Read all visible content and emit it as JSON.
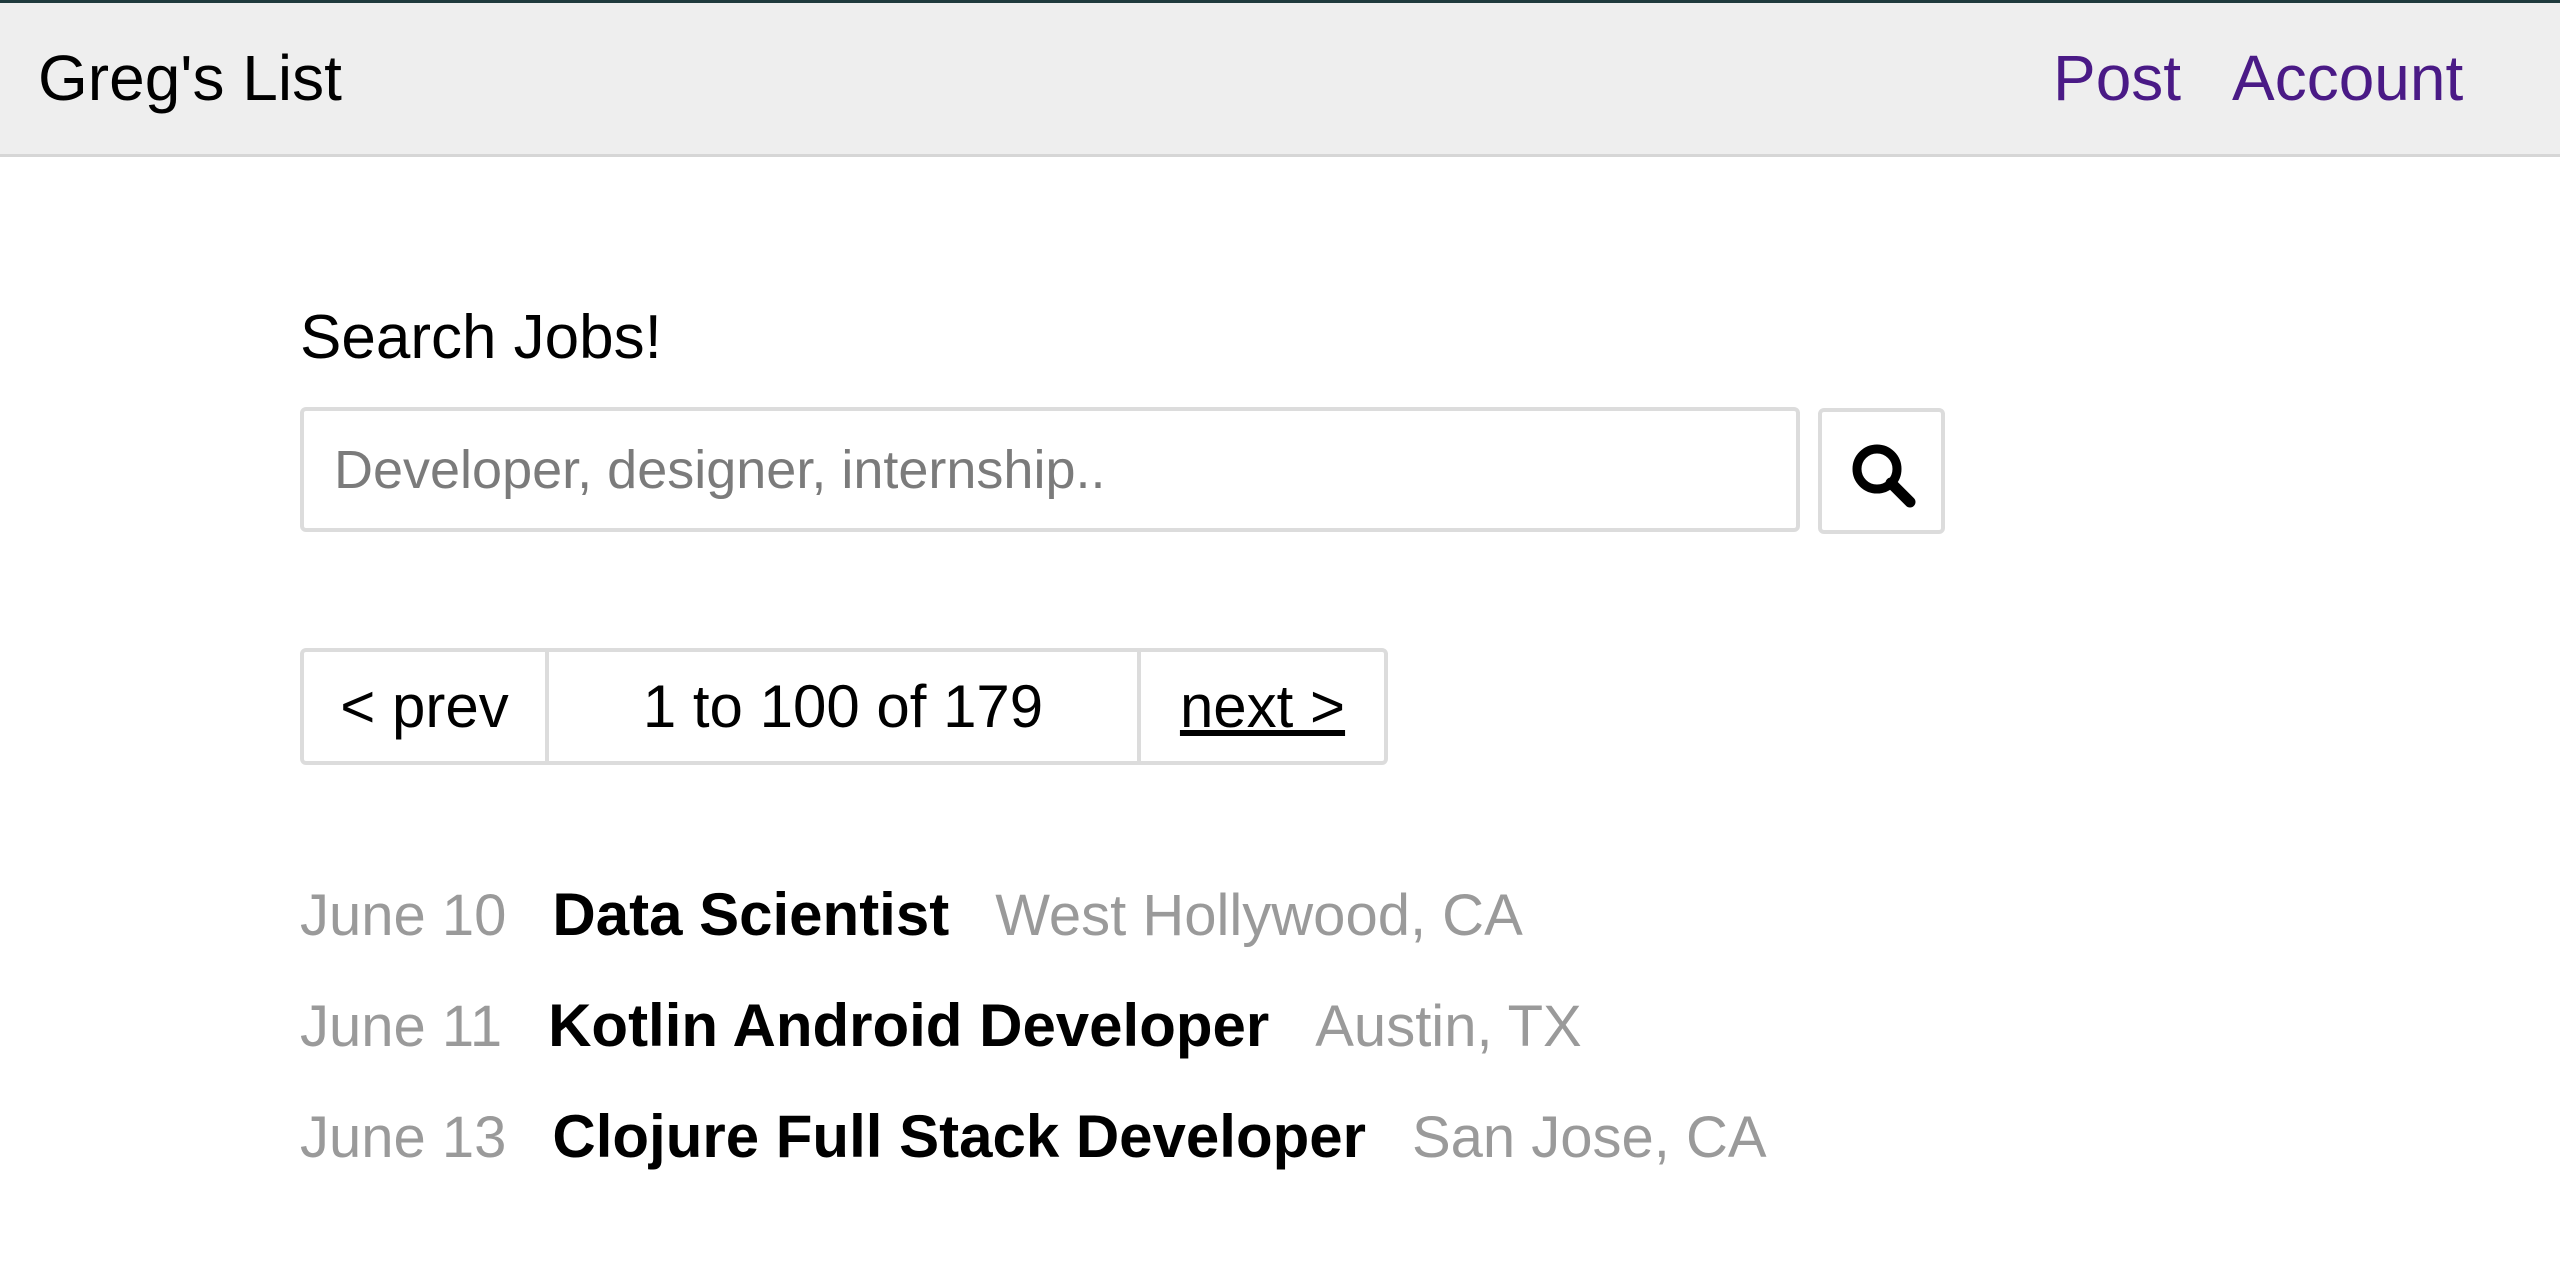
{
  "header": {
    "brand": "Greg's List",
    "nav": {
      "post": "Post",
      "account": "Account"
    },
    "link_color": "#4a1a86"
  },
  "search": {
    "heading": "Search Jobs!",
    "placeholder": "Developer, designer, internship..",
    "value": "",
    "button_icon": "search-icon"
  },
  "pagination": {
    "prev_label": "< prev",
    "range_label": "1 to 100 of 179",
    "next_label": "next >"
  },
  "jobs": [
    {
      "date": "June 10",
      "title": "Data Scientist",
      "location": "West Hollywood, CA"
    },
    {
      "date": "June 11",
      "title": "Kotlin Android Developer",
      "location": "Austin, TX"
    },
    {
      "date": "June 13",
      "title": "Clojure Full Stack Developer",
      "location": "San Jose, CA"
    }
  ]
}
